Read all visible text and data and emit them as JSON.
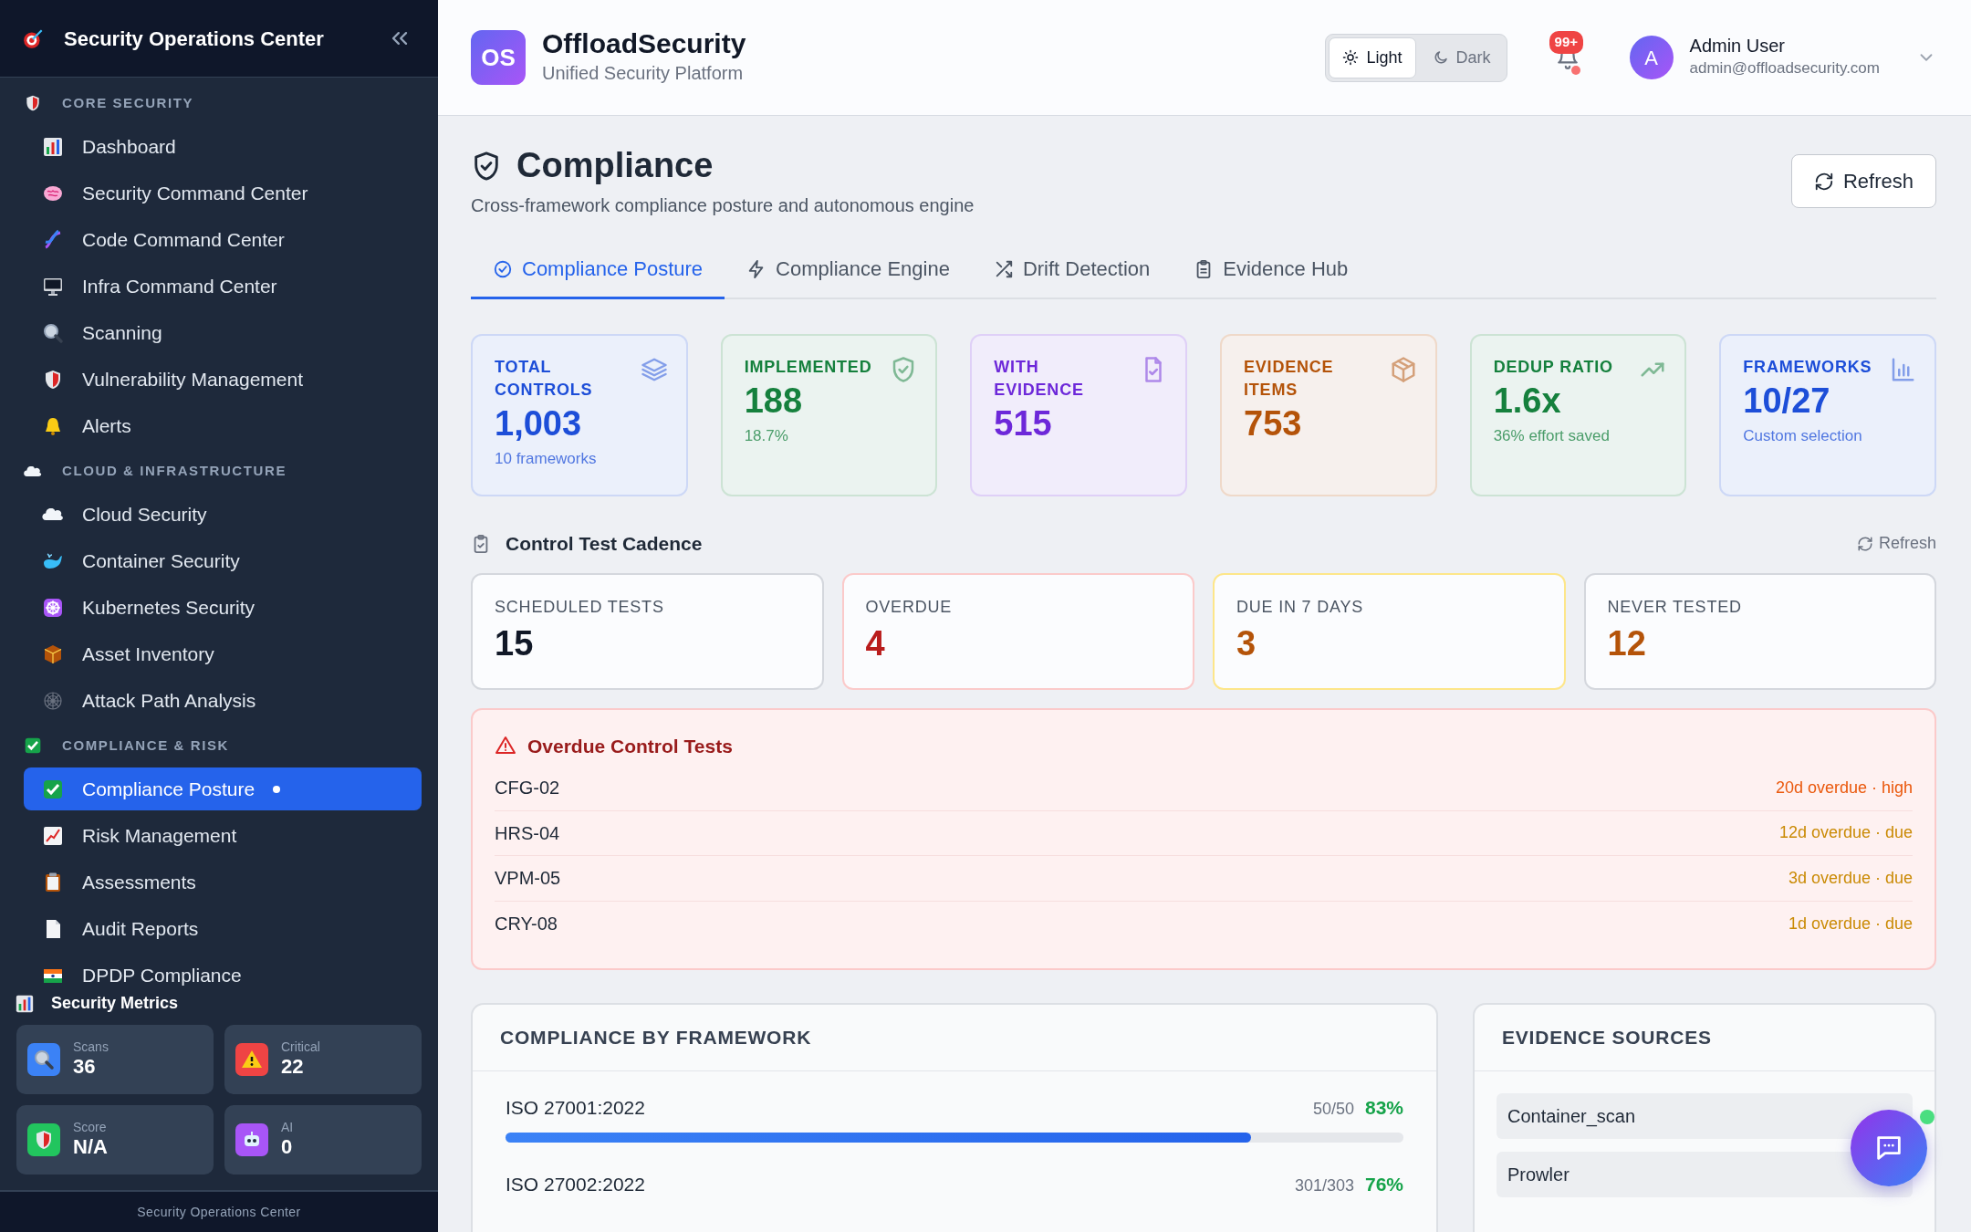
{
  "sidebar": {
    "title": "Security Operations Center",
    "sections": [
      {
        "title": "CORE SECURITY",
        "items": [
          {
            "label": "Dashboard",
            "selected": false
          },
          {
            "label": "Security Command Center",
            "selected": false
          },
          {
            "label": "Code Command Center",
            "selected": false
          },
          {
            "label": "Infra Command Center",
            "selected": false
          },
          {
            "label": "Scanning",
            "selected": false
          },
          {
            "label": "Vulnerability Management",
            "selected": false
          },
          {
            "label": "Alerts",
            "selected": false
          }
        ]
      },
      {
        "title": "CLOUD & INFRASTRUCTURE",
        "items": [
          {
            "label": "Cloud Security",
            "selected": false
          },
          {
            "label": "Container Security",
            "selected": false
          },
          {
            "label": "Kubernetes Security",
            "selected": false
          },
          {
            "label": "Asset Inventory",
            "selected": false
          },
          {
            "label": "Attack Path Analysis",
            "selected": false
          }
        ]
      },
      {
        "title": "COMPLIANCE & RISK",
        "items": [
          {
            "label": "Compliance Posture",
            "selected": true
          },
          {
            "label": "Risk Management",
            "selected": false
          },
          {
            "label": "Assessments",
            "selected": false
          },
          {
            "label": "Audit Reports",
            "selected": false
          },
          {
            "label": "DPDP Compliance",
            "selected": false
          }
        ]
      }
    ],
    "metrics_title": "Security Metrics",
    "metrics": [
      {
        "label": "Scans",
        "value": "36",
        "color": "#3b82f6"
      },
      {
        "label": "Critical",
        "value": "22",
        "color": "#ef4444"
      },
      {
        "label": "Score",
        "value": "N/A",
        "color": "#22c55e"
      },
      {
        "label": "AI",
        "value": "0",
        "color": "#a855f7"
      }
    ],
    "footer": "Security Operations Center"
  },
  "header": {
    "logo": "OS",
    "brand": "OffloadSecurity",
    "tagline": "Unified Security Platform",
    "theme_options": [
      {
        "label": "Light",
        "selected": true
      },
      {
        "label": "Dark",
        "selected": false
      }
    ],
    "notification_badge": "99+",
    "user": {
      "avatar": "A",
      "name": "Admin User",
      "email": "admin@offloadsecurity.com"
    }
  },
  "page": {
    "title": "Compliance",
    "subtitle": "Cross-framework compliance posture and autonomous engine",
    "refresh": "Refresh"
  },
  "tabs": [
    {
      "label": "Compliance Posture",
      "selected": true
    },
    {
      "label": "Compliance Engine",
      "selected": false
    },
    {
      "label": "Drift Detection",
      "selected": false
    },
    {
      "label": "Evidence Hub",
      "selected": false
    }
  ],
  "stats": [
    {
      "label": "TOTAL CONTROLS",
      "value": "1,003",
      "note": "10 frameworks",
      "color": "#1d4ed8"
    },
    {
      "label": "IMPLEMENTED",
      "value": "188",
      "note": "18.7%",
      "color": "#15803d"
    },
    {
      "label": "WITH EVIDENCE",
      "value": "515",
      "color": "#6d28d9"
    },
    {
      "label": "EVIDENCE ITEMS",
      "value": "753",
      "color": "#b45309"
    },
    {
      "label": "DEDUP RATIO",
      "value": "1.6x",
      "note": "36% effort saved",
      "color": "#15803d"
    },
    {
      "label": "FRAMEWORKS",
      "value": "10/27",
      "note": "Custom selection",
      "color": "#1d4ed8"
    }
  ],
  "cadence": {
    "title": "Control Test Cadence",
    "refresh": "Refresh",
    "cards": [
      {
        "kind": "scheduled",
        "label": "SCHEDULED TESTS",
        "value": "15"
      },
      {
        "kind": "overdue",
        "label": "OVERDUE",
        "value": "4"
      },
      {
        "kind": "due",
        "label": "DUE IN 7 DAYS",
        "value": "3"
      },
      {
        "kind": "never",
        "label": "NEVER TESTED",
        "value": "12"
      }
    ]
  },
  "overdue": {
    "title": "Overdue Control Tests",
    "rows": [
      {
        "id": "CFG-02",
        "status": "20d overdue · high",
        "color": "#ea580c"
      },
      {
        "id": "HRS-04",
        "status": "12d overdue · due",
        "color": "#ca8a04"
      },
      {
        "id": "VPM-05",
        "status": "3d overdue · due",
        "color": "#ca8a04"
      },
      {
        "id": "CRY-08",
        "status": "1d overdue · due",
        "color": "#ca8a04"
      }
    ]
  },
  "frameworks": {
    "title": "COMPLIANCE BY FRAMEWORK",
    "rows": [
      {
        "name": "ISO 27001:2022",
        "count": "50/50",
        "percent": "83%",
        "level": 0.83
      },
      {
        "name": "ISO 27002:2022",
        "count": "301/303",
        "percent": "76%"
      }
    ]
  },
  "evidence_sources": {
    "title": "EVIDENCE SOURCES",
    "items": [
      "Container_scan",
      "Prowler"
    ]
  }
}
